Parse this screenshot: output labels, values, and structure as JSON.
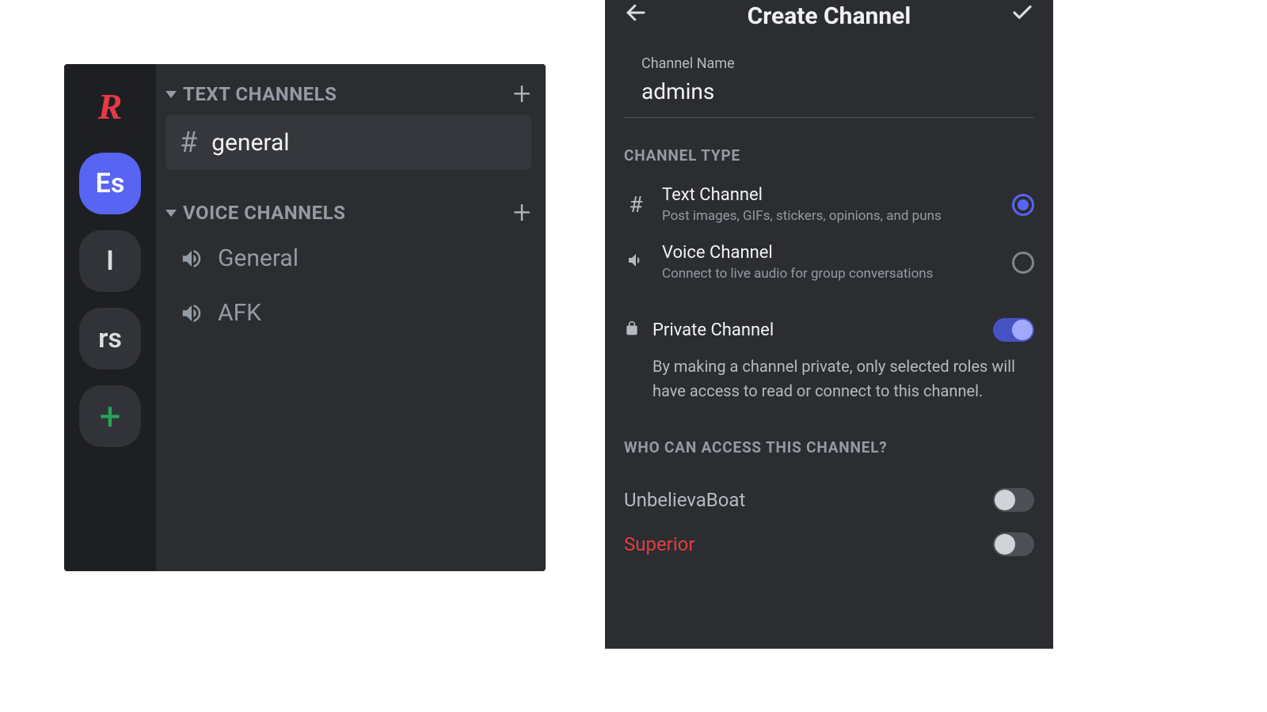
{
  "left": {
    "servers": [
      {
        "label": "R",
        "kind": "logo"
      },
      {
        "label": "Es",
        "kind": "selected"
      },
      {
        "label": "I",
        "kind": "normal"
      },
      {
        "label": "rs",
        "kind": "normal"
      },
      {
        "label": "+",
        "kind": "add"
      }
    ],
    "text_group": {
      "title": "TEXT CHANNELS"
    },
    "voice_group": {
      "title": "VOICE CHANNELS"
    },
    "channels": {
      "text": [
        {
          "name": "general",
          "selected": true
        }
      ],
      "voice": [
        {
          "name": "General"
        },
        {
          "name": "AFK"
        }
      ]
    }
  },
  "right": {
    "title": "Create Channel",
    "channel_name_label": "Channel Name",
    "channel_name_value": "admins",
    "channel_type_title": "CHANNEL TYPE",
    "types": [
      {
        "name": "Text Channel",
        "desc": "Post images, GIFs, stickers, opinions, and puns",
        "selected": true
      },
      {
        "name": "Voice Channel",
        "desc": "Connect to live audio for group conversations",
        "selected": false
      }
    ],
    "private_label": "Private Channel",
    "private_on": true,
    "private_desc": "By making a channel private, only selected roles will have access to read or connect to this channel.",
    "access_title": "WHO CAN ACCESS THIS CHANNEL?",
    "roles": [
      {
        "name": "UnbelievaBoat",
        "on": false,
        "cls": ""
      },
      {
        "name": "Superior",
        "on": false,
        "cls": "superior"
      }
    ]
  }
}
